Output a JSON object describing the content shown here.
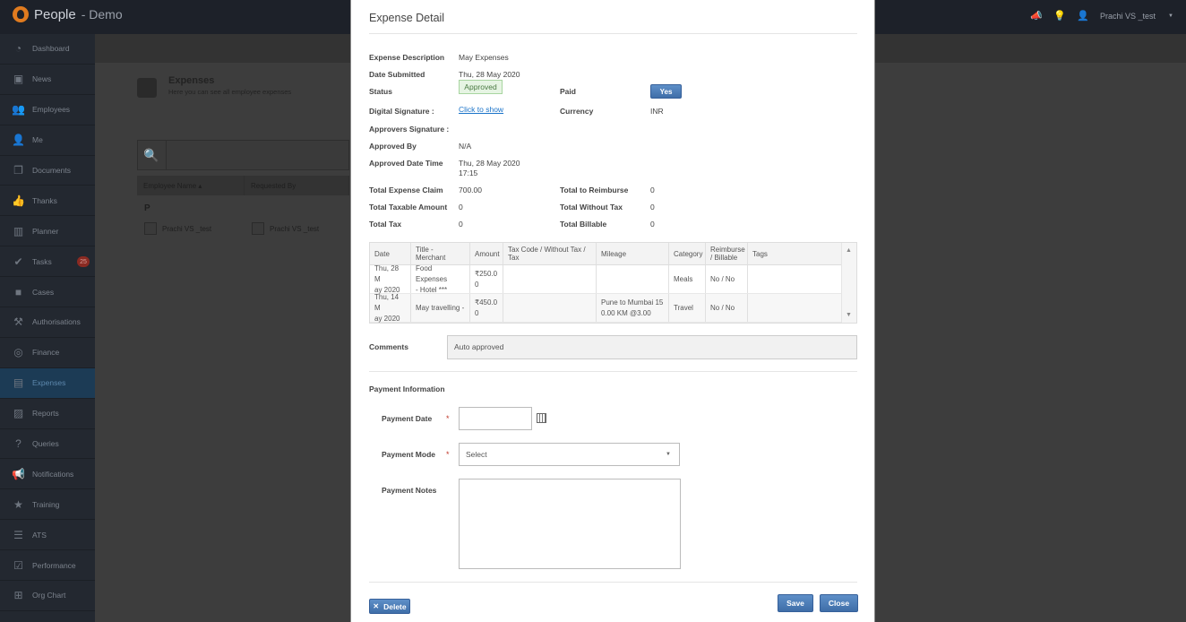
{
  "app": {
    "name": "People",
    "subtitle": "- Demo"
  },
  "topbar": {
    "user_name": "Prachi VS _test"
  },
  "sidebar": {
    "items": [
      {
        "label": "Dashboard",
        "icon": "dashboard-icon",
        "glyph": "◔"
      },
      {
        "label": "News",
        "icon": "tv-icon",
        "glyph": "▣"
      },
      {
        "label": "Employees",
        "icon": "group-icon",
        "glyph": "👥"
      },
      {
        "label": "Me",
        "icon": "user-icon",
        "glyph": "👤"
      },
      {
        "label": "Documents",
        "icon": "documents-icon",
        "glyph": "❐"
      },
      {
        "label": "Thanks",
        "icon": "thumbs-up-icon",
        "glyph": "👍"
      },
      {
        "label": "Planner",
        "icon": "planner-icon",
        "glyph": "▥"
      },
      {
        "label": "Tasks",
        "icon": "check-icon",
        "glyph": "✔",
        "badge": "25"
      },
      {
        "label": "Cases",
        "icon": "briefcase-icon",
        "glyph": "■"
      },
      {
        "label": "Authorisations",
        "icon": "gavel-icon",
        "glyph": "⚒"
      },
      {
        "label": "Finance",
        "icon": "coins-icon",
        "glyph": "◎"
      },
      {
        "label": "Expenses",
        "icon": "wallet-icon",
        "glyph": "▤",
        "active": true
      },
      {
        "label": "Reports",
        "icon": "chart-icon",
        "glyph": "▨"
      },
      {
        "label": "Queries",
        "icon": "question-icon",
        "glyph": "?"
      },
      {
        "label": "Notifications",
        "icon": "megaphone-icon",
        "glyph": "📢"
      },
      {
        "label": "Training",
        "icon": "star-icon",
        "glyph": "★"
      },
      {
        "label": "ATS",
        "icon": "bars-icon",
        "glyph": "☰"
      },
      {
        "label": "Performance",
        "icon": "checkbox-icon",
        "glyph": "☑"
      },
      {
        "label": "Org Chart",
        "icon": "sitemap-icon",
        "glyph": "⊞"
      }
    ]
  },
  "background": {
    "page_title": "Expenses",
    "page_subtitle": "Here you can see all employee expenses",
    "columns": [
      "Employee Name",
      "Requested By"
    ],
    "group_letter": "P",
    "row": {
      "employee": "Prachi VS _test",
      "requested_by": "Prachi VS _test"
    }
  },
  "modal": {
    "title": "Expense Detail",
    "fields": {
      "expense_description_label": "Expense Description",
      "expense_description": "May Expenses",
      "date_submitted_label": "Date Submitted",
      "date_submitted": "Thu, 28 May 2020",
      "status_label": "Status",
      "status": "Approved",
      "paid_label": "Paid",
      "paid": "Yes",
      "digital_signature_label": "Digital Signature :",
      "digital_signature_link": "Click to show",
      "currency_label": "Currency",
      "currency": "INR",
      "approvers_signature_label": "Approvers Signature :",
      "approved_by_label": "Approved By",
      "approved_by": "N/A",
      "approved_datetime_label": "Approved Date Time",
      "approved_datetime_line1": "Thu, 28 May 2020",
      "approved_datetime_line2": "17:15",
      "total_expense_claim_label": "Total Expense Claim",
      "total_expense_claim": "700.00",
      "total_to_reimburse_label": "Total to Reimburse",
      "total_to_reimburse": "0",
      "total_taxable_amount_label": "Total Taxable Amount",
      "total_taxable_amount": "0",
      "total_without_tax_label": "Total Without Tax",
      "total_without_tax": "0",
      "total_tax_label": "Total Tax",
      "total_tax": "0",
      "total_billable_label": "Total Billable",
      "total_billable": "0"
    },
    "table": {
      "headers": {
        "date": "Date",
        "title": "Title - Merchant",
        "amount": "Amount",
        "taxcode_1": "Tax Code / Without Tax /",
        "taxcode_2": "Tax",
        "mileage": "Mileage",
        "category": "Category",
        "reimburse_1": "Reimburse",
        "reimburse_2": "/ Billable",
        "tags": "Tags"
      },
      "rows": [
        {
          "date_1": "Thu, 28 M",
          "date_2": "ay 2020",
          "title_1": "Food Expenses",
          "title_2": "- Hotel ***",
          "amount_1": "₹250.0",
          "amount_2": "0",
          "taxcode": "",
          "mileage_1": "",
          "mileage_2": "",
          "category": "Meals",
          "reimburse": "No / No",
          "tags": ""
        },
        {
          "date_1": "Thu, 14 M",
          "date_2": "ay 2020",
          "title_1": "May travelling -",
          "title_2": "",
          "amount_1": "₹450.0",
          "amount_2": "0",
          "taxcode": "",
          "mileage_1": "Pune to Mumbai 15",
          "mileage_2": "0.00 KM @3.00",
          "category": "Travel",
          "reimburse": "No / No",
          "tags": ""
        }
      ]
    },
    "comments_label": "Comments",
    "comments": "Auto approved",
    "payment": {
      "section_title": "Payment Information",
      "date_label": "Payment Date",
      "mode_label": "Payment Mode",
      "mode_value": "Select",
      "notes_label": "Payment Notes",
      "required_mark": "*"
    },
    "buttons": {
      "delete": "Delete",
      "save": "Save",
      "close": "Close"
    }
  }
}
